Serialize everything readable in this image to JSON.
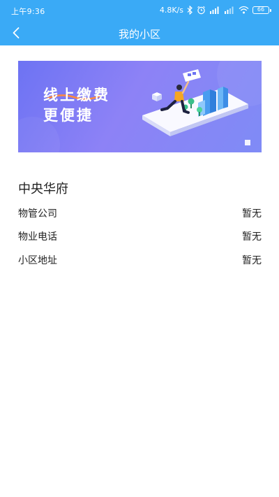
{
  "status_bar": {
    "time": "上午9:36",
    "network_speed": "4.8K/s",
    "battery": "66",
    "icons": [
      "bluetooth-icon",
      "alarm-icon",
      "signal-icon",
      "signal-icon",
      "wifi-icon",
      "battery-icon"
    ]
  },
  "nav": {
    "title": "我的小区",
    "back_icon": "chevron-left-icon"
  },
  "banner": {
    "line1": "线上缴费",
    "line2": "更便捷",
    "colors": {
      "start": "#6d73f3",
      "end": "#7f8bf6"
    }
  },
  "community": {
    "name": "中央华府",
    "rows": [
      {
        "label": "物管公司",
        "value": "暂无"
      },
      {
        "label": "物业电话",
        "value": "暂无"
      },
      {
        "label": "小区地址",
        "value": "暂无"
      }
    ]
  },
  "colors": {
    "header": "#3aaaf6",
    "background": "#ffffff"
  }
}
